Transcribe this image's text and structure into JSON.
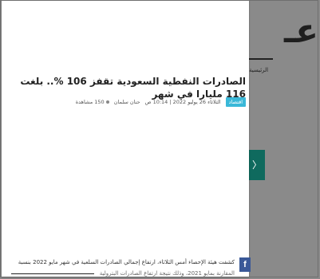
{
  "background": {
    "logo_text": "عـ",
    "nav_home": "الرئيسية",
    "next_arrow": "〉"
  },
  "article": {
    "title": "الصادرات النفطية السعودية تقفز 106 %.. بلغت 116 مليارا في شهر",
    "category": "اقتصاد",
    "date": "الثلاثاء 26 يوليو 2022 | 10:14 ص",
    "author": "حنان سلمان",
    "views": "150 مشاهدة",
    "body_line_1": "كشفت هيئة الإحصاء أمس الثلاثاء، ارتفاع إجمالي الصادرات السلعية في شهر مايو 2022 بنسبة",
    "body_line_2": "المقارنة بمايو 2021، وذلك نتيجة ارتفاع الصادرات البترولية"
  },
  "share": {
    "facebook_glyph": "f"
  },
  "colors": {
    "accent_teal": "#0f6a5e",
    "category_badge": "#3ab8d8",
    "facebook": "#3b5998"
  }
}
